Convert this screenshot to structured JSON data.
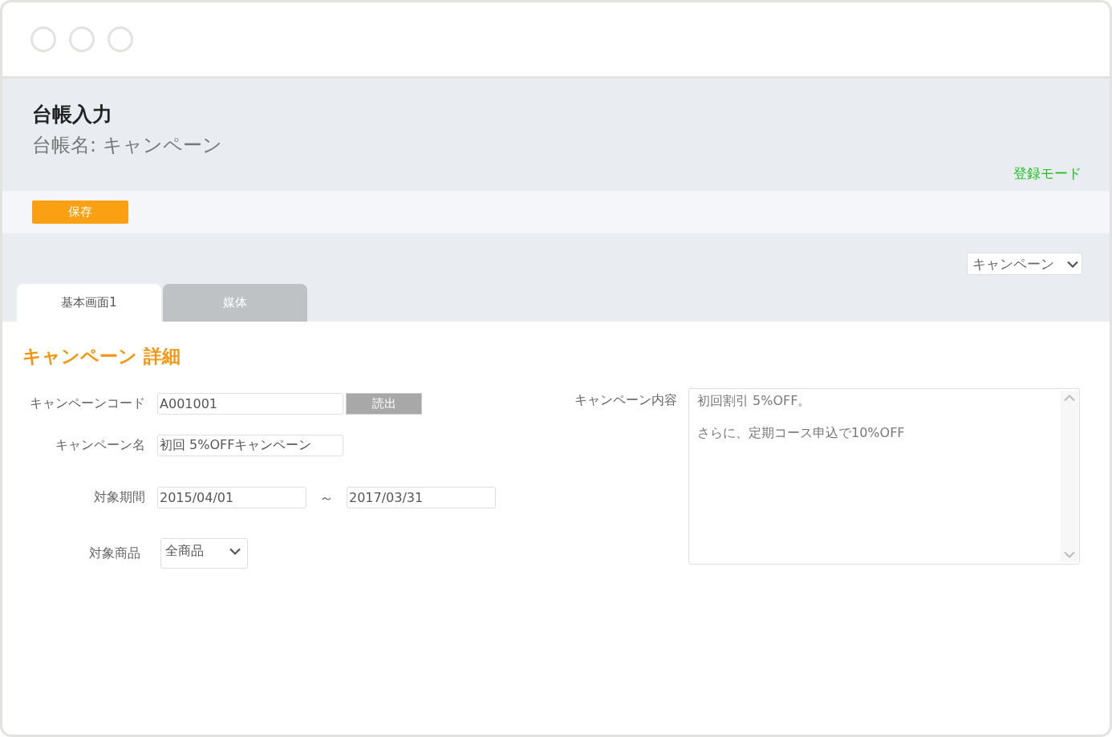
{
  "header": {
    "title": "台帳入力",
    "subtitle": "台帳名: キャンペーン",
    "mode": "登録モード"
  },
  "toolbar": {
    "save_button": "保存"
  },
  "ledger_select": {
    "value": "キャンペーン"
  },
  "tabs": [
    {
      "label": "基本画面1",
      "selected": true
    },
    {
      "label": "媒体",
      "selected": false
    }
  ],
  "section_title": "キャンペーン 詳細",
  "form": {
    "code": {
      "label": "キャンペーンコード",
      "value": "A001001",
      "button": "読出"
    },
    "name": {
      "label": "キャンペーン名",
      "value": "初回 5%OFFキャンペーン"
    },
    "period": {
      "label": "対象期間",
      "start": "2015/04/01",
      "separator": "～",
      "end": "2017/03/31"
    },
    "product": {
      "label": "対象商品",
      "value": "全商品"
    },
    "content": {
      "label": "キャンペーン内容",
      "lines": [
        "初回割引 5%OFF。",
        "さらに、定期コース申込で10%OFF"
      ]
    }
  }
}
